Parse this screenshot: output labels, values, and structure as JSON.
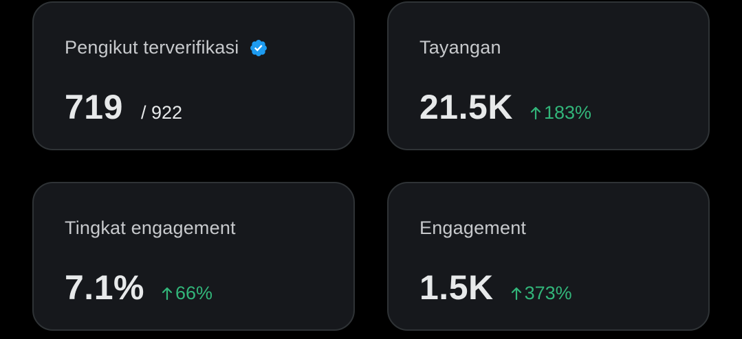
{
  "cards": [
    {
      "label": "Pengikut terverifikasi",
      "badge_icon": "verified-badge-icon",
      "value": "719",
      "total": "/ 922"
    },
    {
      "label": "Tayangan",
      "value": "21.5K",
      "delta": "183%",
      "delta_icon": "arrow-up-icon"
    },
    {
      "label": "Tingkat engagement",
      "value": "7.1%",
      "delta": "66%",
      "delta_icon": "arrow-up-icon"
    },
    {
      "label": "Engagement",
      "value": "1.5K",
      "delta": "373%",
      "delta_icon": "arrow-up-icon"
    }
  ],
  "colors": {
    "background": "#000000",
    "card_background": "#16181c",
    "card_border": "#2f3336",
    "label": "#c7c9cc",
    "value": "#e7e9ea",
    "positive_delta": "#32b67a",
    "verified_blue": "#1d9bf0"
  }
}
